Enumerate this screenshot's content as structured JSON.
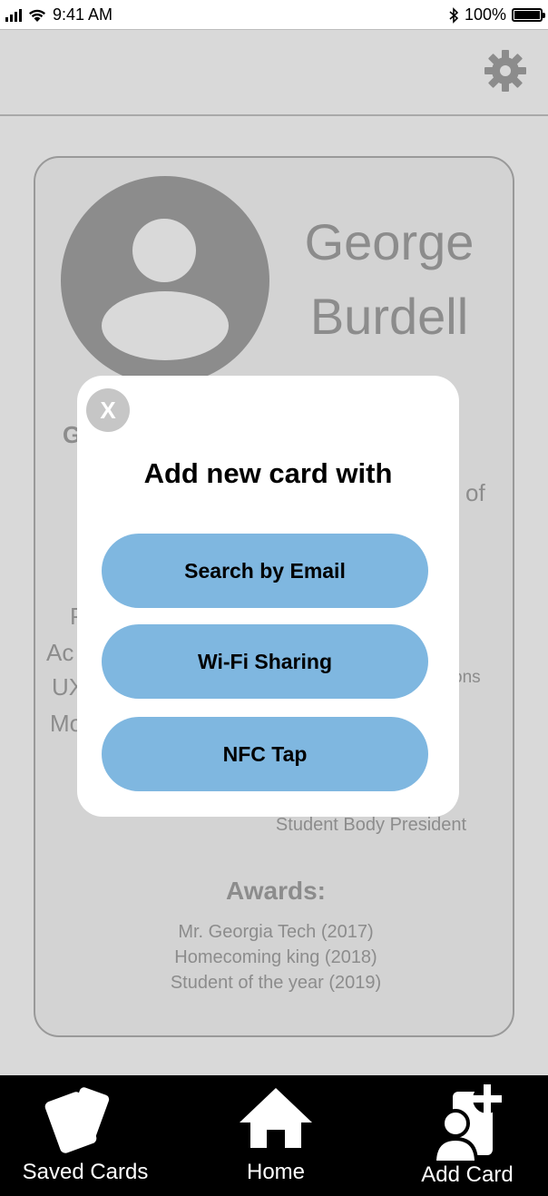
{
  "status": {
    "time": "9:41 AM",
    "battery": "100%"
  },
  "header": {
    "settings_icon": "gear-icon"
  },
  "profile": {
    "first_name": "George",
    "last_name": "Burdell",
    "frag_g": "G",
    "frag_of": "of",
    "frag_p": "P",
    "frag_ac": "Ac",
    "frag_ux": "UX",
    "frag_mo": "Mo",
    "frag_ons": "ons",
    "president": "Student Body President",
    "awards_title": "Awards:",
    "awards": [
      "Mr. Georgia Tech (2017)",
      "Homecoming king (2018)",
      "Student of the year (2019)"
    ]
  },
  "modal": {
    "close_label": "X",
    "title": "Add new card with",
    "options": [
      "Search by Email",
      "Wi-Fi Sharing",
      "NFC Tap"
    ]
  },
  "nav": {
    "items": [
      {
        "label": "Saved Cards",
        "icon": "cards-icon"
      },
      {
        "label": "Home",
        "icon": "home-icon"
      },
      {
        "label": "Add Card",
        "icon": "add-contact-icon"
      }
    ]
  },
  "colors": {
    "accent": "#7fb7e0",
    "background": "#d9d9d9",
    "nav": "#000000"
  }
}
